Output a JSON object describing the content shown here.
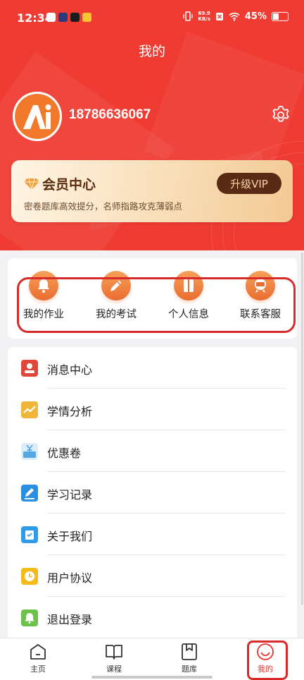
{
  "status_bar": {
    "time": "12:34",
    "net_speed": "69.9",
    "net_unit": "KB/s",
    "battery": "45%"
  },
  "header": {
    "title": "我的"
  },
  "profile": {
    "phone": "18786636067"
  },
  "vip": {
    "title": "会员中心",
    "subtitle": "密卷题库高效提分，名师指路攻克薄弱点",
    "button": "升级VIP"
  },
  "quick_actions": [
    {
      "label": "我的作业",
      "icon": "bell-icon"
    },
    {
      "label": "我的考试",
      "icon": "pencil-icon"
    },
    {
      "label": "个人信息",
      "icon": "book-icon"
    },
    {
      "label": "联系客服",
      "icon": "vip-badge-icon"
    }
  ],
  "menu": [
    {
      "label": "消息中心",
      "icon": "person-card-icon",
      "color": "#e0473a"
    },
    {
      "label": "学情分析",
      "icon": "trend-chart-icon",
      "color": "#f1b53a"
    },
    {
      "label": "优惠卷",
      "icon": "coupon-icon",
      "color": "#55a7e6"
    },
    {
      "label": "学习记录",
      "icon": "edit-pen-icon",
      "color": "#2a8fe0"
    },
    {
      "label": "关于我们",
      "icon": "info-bag-icon",
      "color": "#2f9be9"
    },
    {
      "label": "用户协议",
      "icon": "clock-icon",
      "color": "#f5bb1b"
    },
    {
      "label": "退出登录",
      "icon": "bell-exit-icon",
      "color": "#6cc24a"
    }
  ],
  "tabbar": [
    {
      "label": "主页",
      "icon": "home-icon"
    },
    {
      "label": "课程",
      "icon": "book-open-icon"
    },
    {
      "label": "题库",
      "icon": "bookmark-icon"
    },
    {
      "label": "我的",
      "icon": "smile-icon",
      "active": true
    }
  ],
  "colors": {
    "primary": "#ef3b32",
    "highlight": "#d92a2a",
    "vip_button": "#5a2b14",
    "active_tab": "#e8302a"
  }
}
